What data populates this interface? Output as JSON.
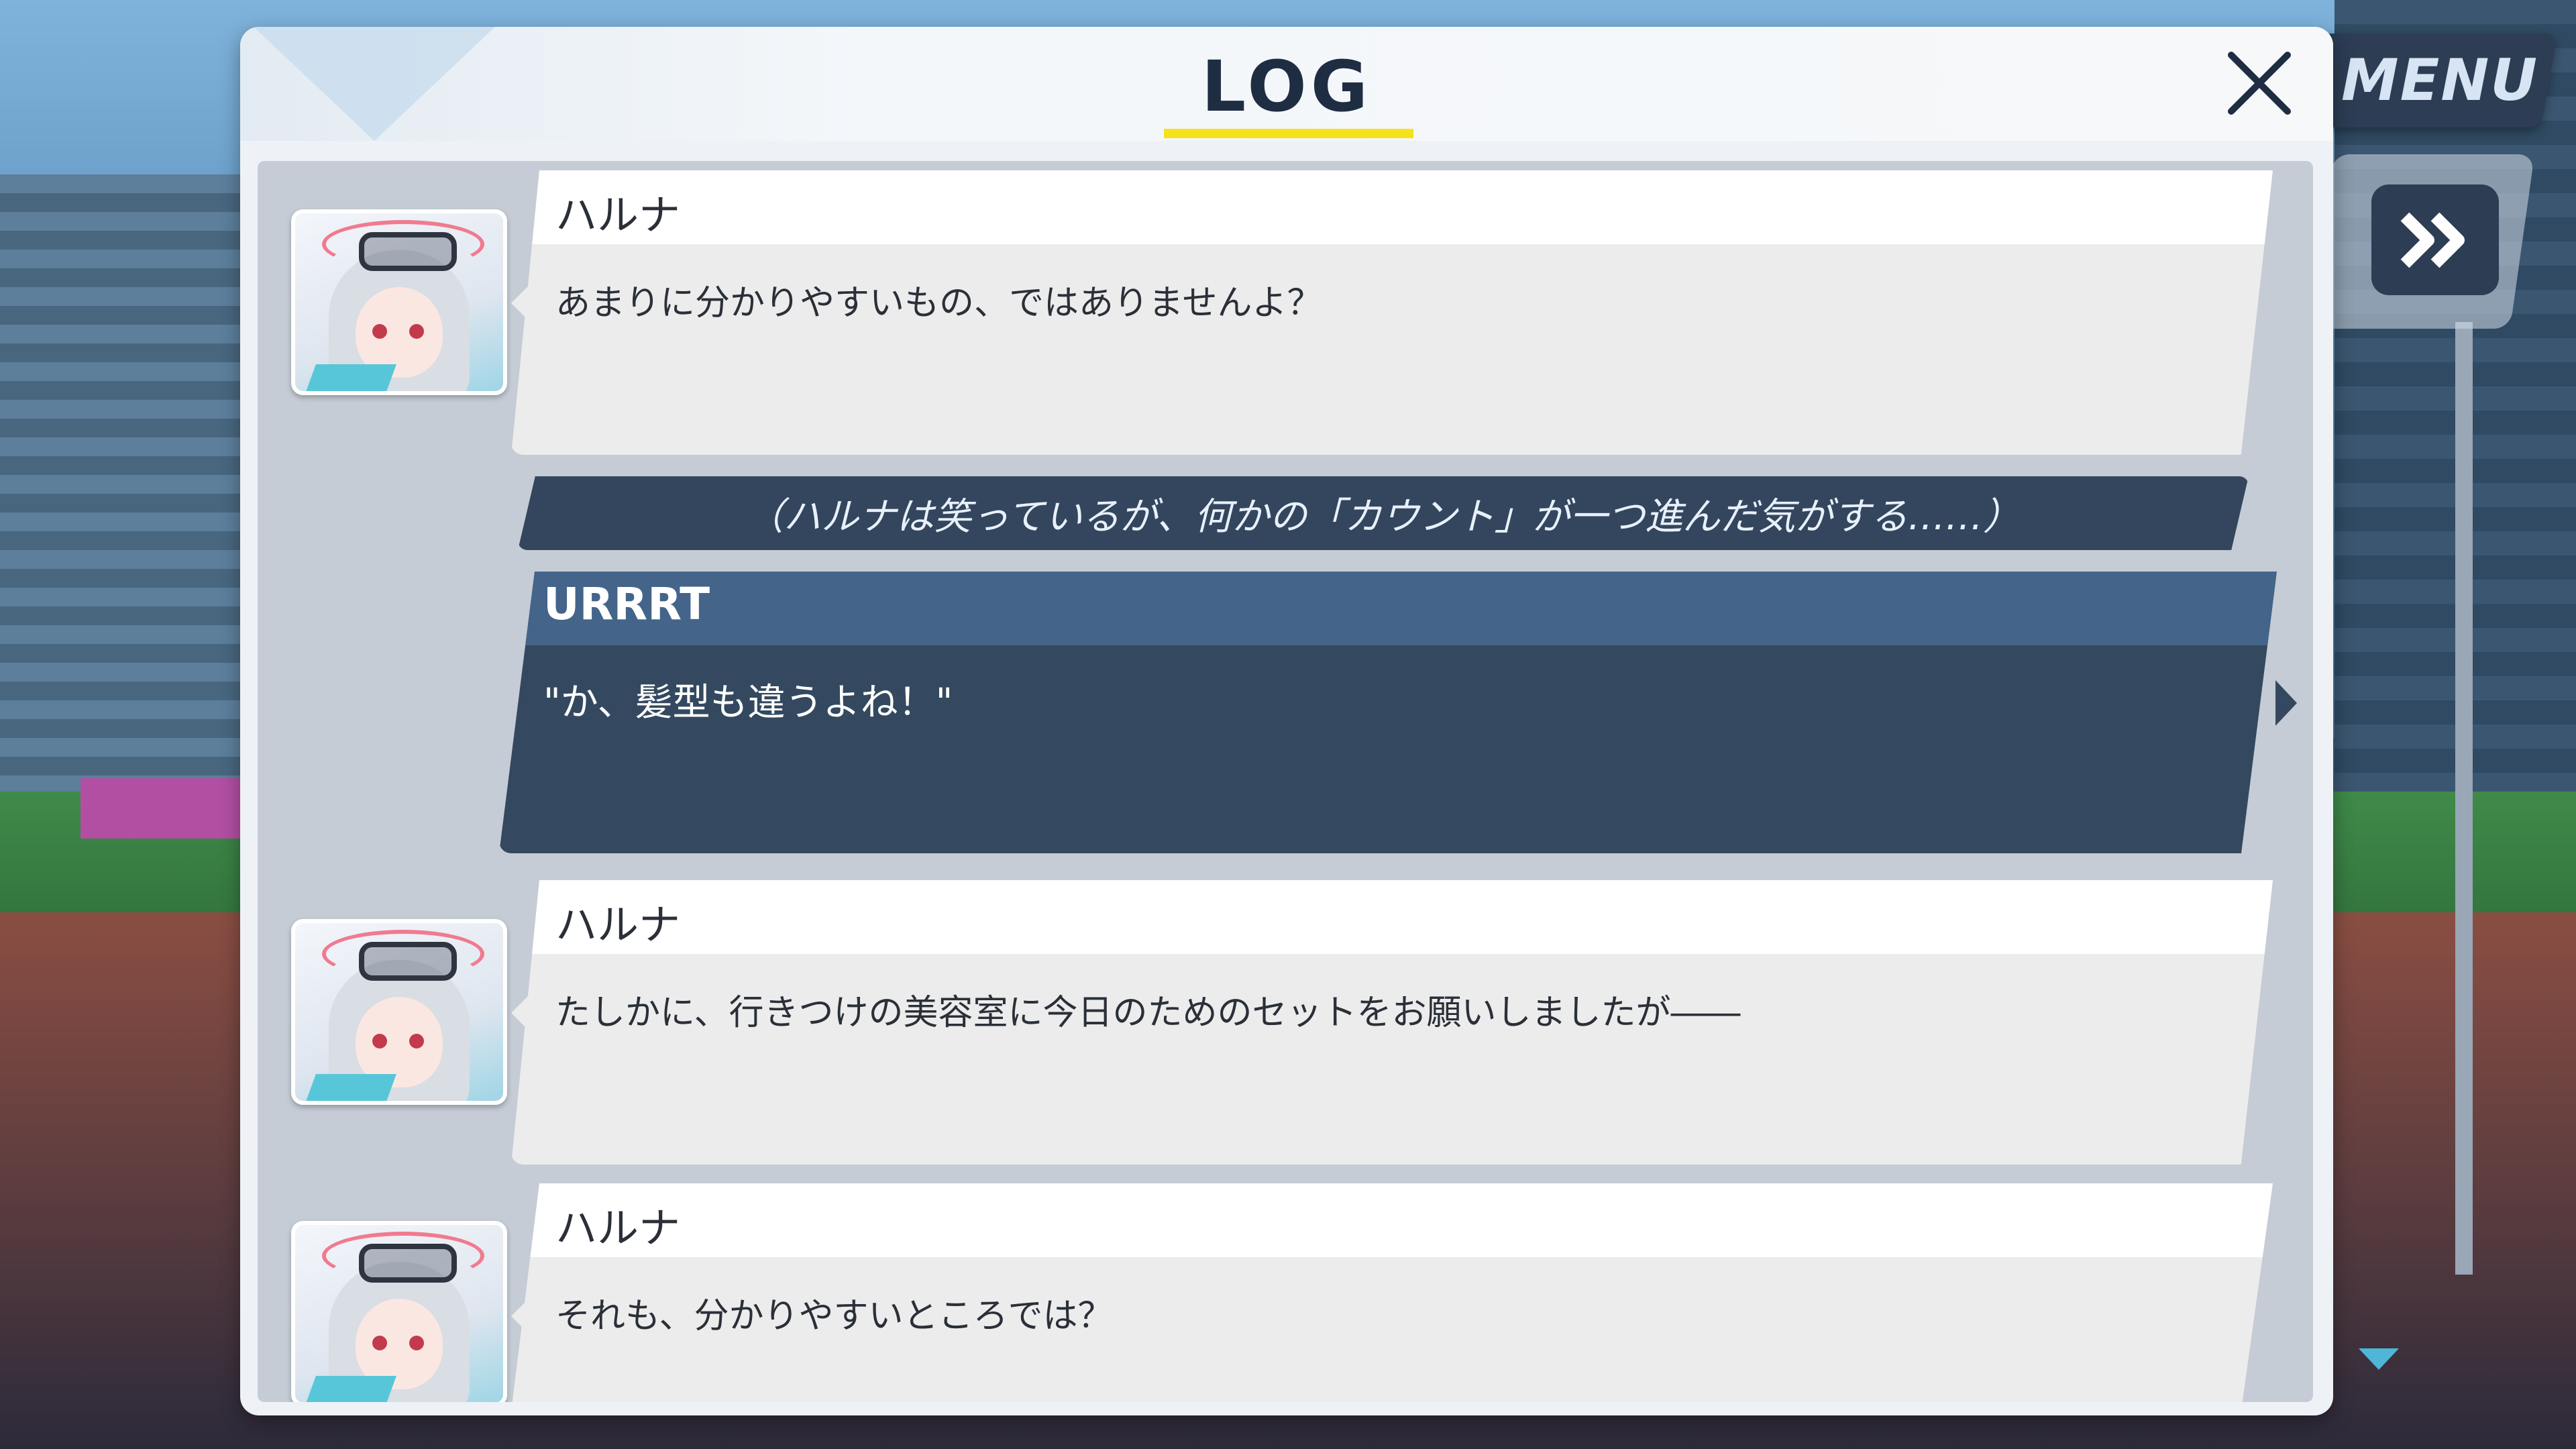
{
  "header": {
    "title": "LOG"
  },
  "hud": {
    "menu_label": "MENU"
  },
  "messages": [
    {
      "speaker": "ハルナ",
      "text": "あまりに分かりやすいもの、ではありませんよ？"
    },
    {
      "speaker": "ハルナ",
      "text": "たしかに、行きつけの美容室に今日のためのセットをお願いしましたが――"
    },
    {
      "speaker": "ハルナ",
      "text": "それも、分かりやすいところでは？"
    }
  ],
  "narration": {
    "text": "（ハルナは笑っているが、何かの「カウント」が一つ進んだ気がする……）"
  },
  "player_message": {
    "speaker": "URRRT",
    "text": "\"か、髪型も違うよね！\""
  },
  "colors": {
    "accent_yellow": "#f5e21b",
    "narration_bg": "#33465e",
    "player_name_bg": "#44648a",
    "scroll_indicator": "#4fb6d8"
  }
}
